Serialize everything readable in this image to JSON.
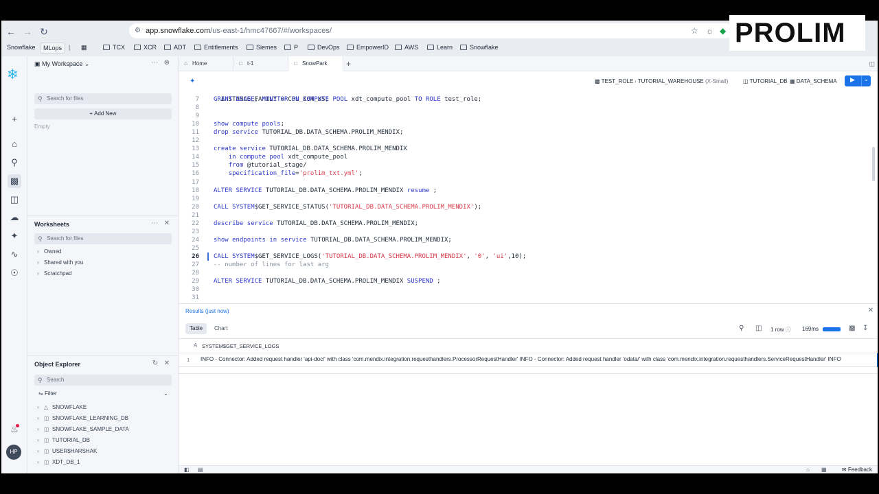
{
  "browser": {
    "url_host": "app.snowflake.com",
    "url_path": "/us-east-1/hmc47667/#/workspaces/",
    "bookmarks": [
      "Snowflake",
      "MLops",
      "TCX",
      "XCR",
      "ADT",
      "Entitlements",
      "Siemes",
      "P",
      "DevOps",
      "EmpowerID",
      "AWS",
      "Learn",
      "Snowflake"
    ]
  },
  "logo": {
    "text": "PROLIM"
  },
  "rail": {
    "avatar": "HP"
  },
  "sidebar": {
    "workspace_title": "My Workspace",
    "search_placeholder": "Search for files",
    "add_new": "Add New",
    "empty_label": "Empty",
    "worksheets_title": "Worksheets",
    "worksheets_search_placeholder": "Search for files",
    "worksheet_items": [
      "Owned",
      "Shared with you",
      "Scratchpad"
    ],
    "object_explorer_title": "Object Explorer",
    "object_search_placeholder": "Search",
    "filter_label": "Filter",
    "databases": [
      "SNOWFLAKE",
      "SNOWFLAKE_LEARNING_DB",
      "SNOWFLAKE_SAMPLE_DATA",
      "TUTORIAL_DB",
      "USER$HARSHAK",
      "XDT_DB_1"
    ]
  },
  "tabs": [
    "Home",
    "t-1",
    "SnowPark"
  ],
  "context": {
    "role": "TEST_ROLE",
    "warehouse": "TUTORIAL_WAREHOUSE",
    "warehouse_size": "(X-Small)",
    "database": "TUTORIAL_DB",
    "schema": "DATA_SCHEMA"
  },
  "editor": {
    "top_partial": "  INSTANCE_FAMILY = CPU_X64_XS;",
    "lines": [
      {
        "n": "7",
        "text": "GRANT USAGE, MONITOR ON COMPUTE POOL xdt_compute_pool TO ROLE test_role;"
      },
      {
        "n": "8",
        "text": ""
      },
      {
        "n": "9",
        "text": ""
      },
      {
        "n": "10",
        "text": "show compute pools;"
      },
      {
        "n": "11",
        "text": "drop service TUTORIAL_DB.DATA_SCHEMA.PROLIM_MENDIX;"
      },
      {
        "n": "12",
        "text": ""
      },
      {
        "n": "13",
        "text": "create service TUTORIAL_DB.DATA_SCHEMA.PROLIM_MENDIX"
      },
      {
        "n": "14",
        "text": "    in compute pool xdt_compute_pool"
      },
      {
        "n": "15",
        "text": "    from @tutorial_stage/"
      },
      {
        "n": "16",
        "text": "    specification_file='prolim_txt.yml';"
      },
      {
        "n": "17",
        "text": ""
      },
      {
        "n": "18",
        "text": "ALTER SERVICE TUTORIAL_DB.DATA_SCHEMA.PROLIM_MENDIX resume ;"
      },
      {
        "n": "19",
        "text": ""
      },
      {
        "n": "20",
        "text": "CALL SYSTEM$GET_SERVICE_STATUS('TUTORIAL_DB.DATA_SCHEMA.PROLIM_MENDIX');"
      },
      {
        "n": "21",
        "text": ""
      },
      {
        "n": "22",
        "text": "describe service TUTORIAL_DB.DATA_SCHEMA.PROLIM_MENDIX;"
      },
      {
        "n": "23",
        "text": ""
      },
      {
        "n": "24",
        "text": "show endpoints in service TUTORIAL_DB.DATA_SCHEMA.PROLIM_MENDIX;"
      },
      {
        "n": "25",
        "text": ""
      },
      {
        "n": "26",
        "text": "CALL SYSTEM$GET_SERVICE_LOGS('TUTORIAL_DB.DATA_SCHEMA.PROLIM_MENDIX', '0', 'ui',10);"
      },
      {
        "n": "27",
        "text": "-- number of lines for last arg"
      },
      {
        "n": "28",
        "text": ""
      },
      {
        "n": "29",
        "text": "ALTER SERVICE TUTORIAL_DB.DATA_SCHEMA.PROLIM_MENDIX SUSPEND ;"
      },
      {
        "n": "30",
        "text": ""
      },
      {
        "n": "31",
        "text": ""
      }
    ],
    "current_line": "26"
  },
  "results": {
    "label": "Results",
    "time": "(just now)",
    "tabs": [
      "Table",
      "Chart"
    ],
    "row_count": "1 row",
    "duration": "169ms",
    "column": "SYSTEM$GET_SERVICE_LOGS",
    "row_number": "1",
    "row_value": "INFO - Connector: Added request handler 'api-doc/' with class 'com.mendix.integration.requesthandlers.ProcessorRequestHandler' INFO - Connector: Added request handler 'odata/' with class 'com.mendix.integration.requesthandlers.ServiceRequestHandler' INFO"
  },
  "statusbar": {
    "feedback": "Feedback"
  },
  "colors": {
    "accent": "#1a73e8",
    "keyword": "#2b37c9",
    "string": "#d63a4a",
    "brand": "#29b5e8"
  }
}
